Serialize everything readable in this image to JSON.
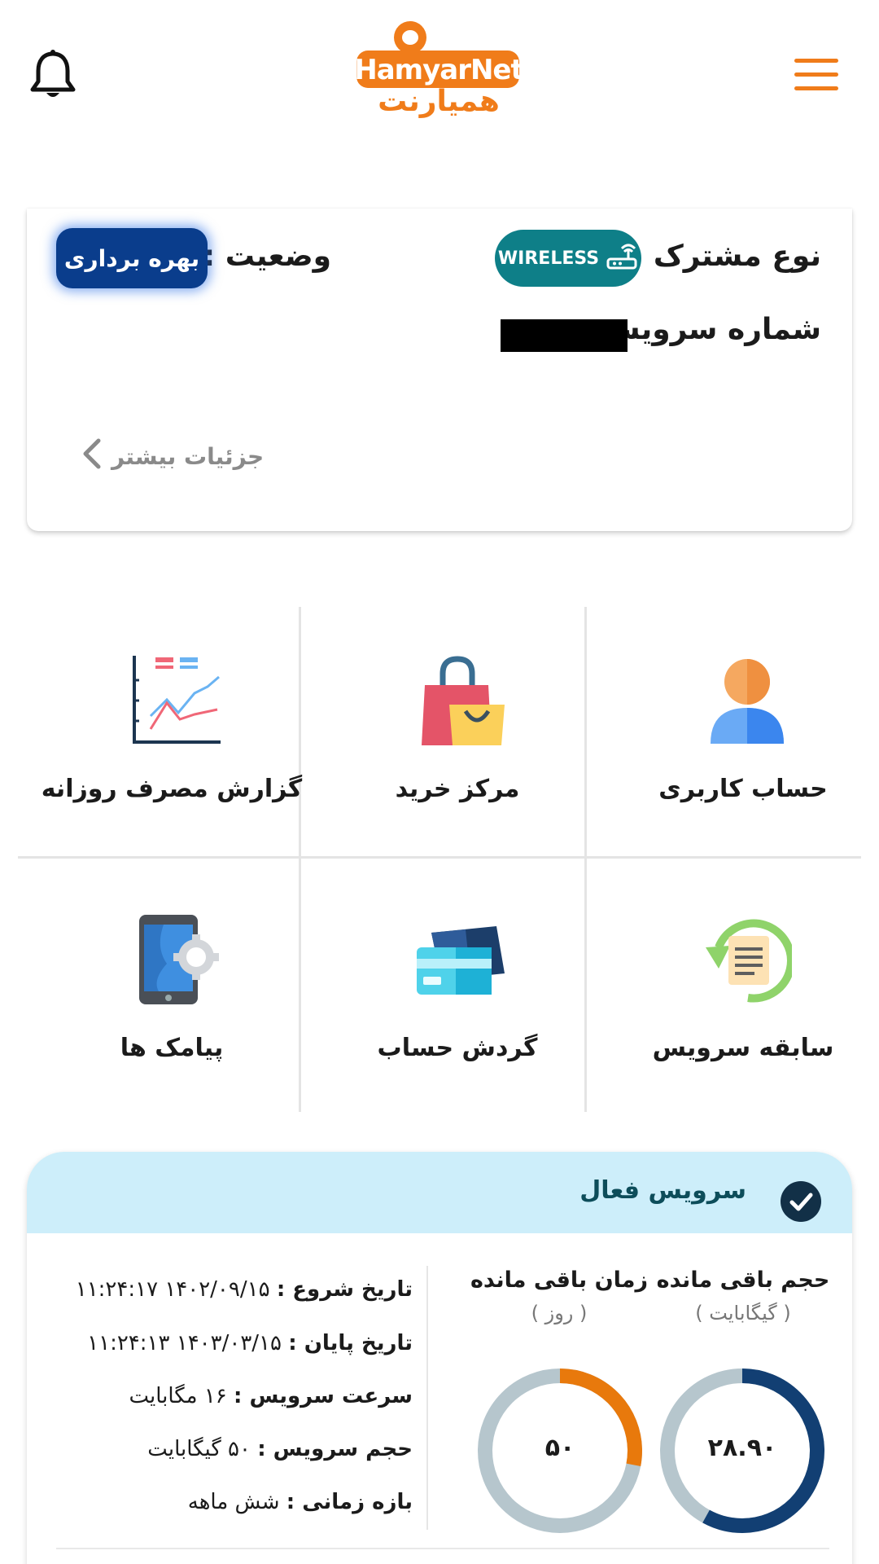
{
  "header": {
    "logo_latin": "HamyarNet",
    "logo_fa": "همیارنت",
    "icons": {
      "bell": "bell-icon",
      "menu": "hamburger-menu-icon"
    }
  },
  "subscriber": {
    "type_label": "نوع مشترک :",
    "type_badge": "WIRELESS",
    "status_label": "وضعیت :",
    "status_value": "بهره برداری",
    "service_number_label": "شماره سرویس :",
    "more_details": "جزئیات بیشتر",
    "colors": {
      "badge": "#0e7f88",
      "status": "#0a3d8c"
    }
  },
  "grid": {
    "items": [
      {
        "label": "حساب کاربری",
        "icon": "user-account-icon"
      },
      {
        "label": "مرکز خرید",
        "icon": "shopping-bag-icon"
      },
      {
        "label": "گزارش مصرف روزانه",
        "icon": "line-chart-icon"
      },
      {
        "label": "سابقه سرویس",
        "icon": "service-history-icon"
      },
      {
        "label": "گردش حساب",
        "icon": "credit-cards-icon"
      },
      {
        "label": "پیامک ها",
        "icon": "phone-settings-icon"
      }
    ]
  },
  "service": {
    "title": "سرویس فعال",
    "remaining_volume": {
      "label": "حجم باقی مانده",
      "unit": "( گیگابایت )",
      "value": "۲۸.۹۰",
      "fraction": 0.58,
      "color": "#123f73"
    },
    "remaining_time": {
      "label": "زمان باقی مانده",
      "unit": "( روز )",
      "value": "۵۰",
      "fraction": 0.28,
      "color": "#e8790c"
    },
    "details": [
      {
        "label": "تاریخ شروع :",
        "value": "۱۴۰۲/۰۹/۱۵ ۱۱:۲۴:۱۷"
      },
      {
        "label": "تاریخ پایان :",
        "value": "۱۴۰۳/۰۳/۱۵ ۱۱:۲۴:۱۳"
      },
      {
        "label": "سرعت سرویس :",
        "value": "۱۶ مگابایت"
      },
      {
        "label": "حجم سرویس :",
        "value": "۵۰ گیگابایت"
      },
      {
        "label": "بازه زمانی :",
        "value": "شش ماهه"
      }
    ]
  }
}
